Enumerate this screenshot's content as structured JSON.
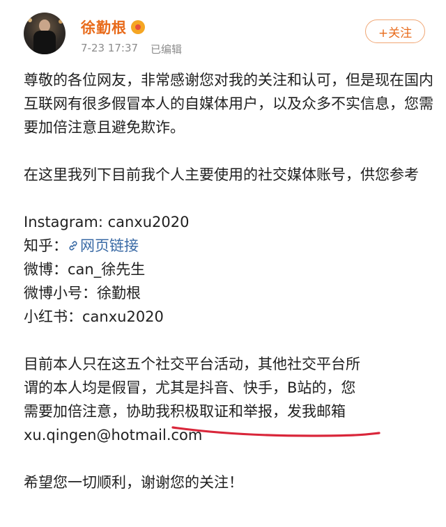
{
  "header": {
    "name": "徐勤根",
    "vip_icon": "vip-badge-icon",
    "timestamp": "7-23 17:37",
    "edited": "已编辑",
    "follow_label": "+关注"
  },
  "post": {
    "p1": "尊敬的各位网友，非常感谢您对我的关注和认可，但是现在国内互联网有很多假冒本人的自媒体用户，以及众多不实信息，您需要加倍注意且避免欺诈。",
    "p2": "在这里我列下目前我个人主要使用的社交媒体账号，供您参考",
    "instagram": "Instagram: canxu2020",
    "zhihu_label": "知乎：",
    "zhihu_link": "网页链接",
    "weibo": "微博：can_徐先生",
    "weibo_alt": "微博小号：徐勤根",
    "xiaohongshu": "小红书：canxu2020",
    "p4_line1": "目前本人只在这五个社交平台活动，其他社交平台所",
    "p4_line2a": "谓的本人均是假冒，",
    "p4_line2b": "尤其是抖音、快手，B站的",
    "p4_line2c": "，您",
    "p4_line3": "需要加倍注意，协助我积极取证和举报，发我邮箱",
    "p4_line4": "xu.qingen@hotmail.com",
    "p5": "希望您一切顺利，谢谢您的关注！"
  },
  "colors": {
    "name": "#e86b1b",
    "link": "#3a6aa5",
    "underline": "#d9263a",
    "meta": "#8c8c8c"
  }
}
